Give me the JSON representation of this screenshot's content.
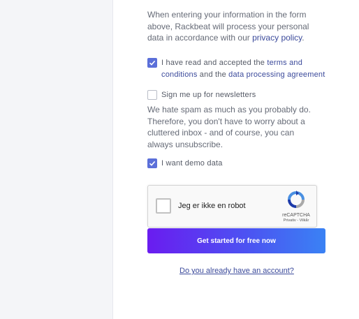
{
  "intro": {
    "text_before": "When entering your information in the form above, Rackbeat will process your personal data in accordance with our ",
    "privacy_link": "privacy policy",
    "text_after": "."
  },
  "terms": {
    "checked": true,
    "text_before": "I have read and accepted the ",
    "terms_link": "terms and conditions",
    "middle": " and the ",
    "agreement_link": "data processing agreement"
  },
  "newsletter": {
    "checked": false,
    "label": "Sign me up for newsletters",
    "note": "We hate spam as much as you probably do. Therefore, you don't have to worry about a cluttered inbox - and of course, you can always unsubscribe."
  },
  "demo": {
    "checked": true,
    "label": "I want demo data"
  },
  "captcha": {
    "label": "Jeg er ikke en robot",
    "brand": "reCAPTCHA",
    "terms": "Privativ - Vilkår"
  },
  "cta_label": "Get started for free now",
  "account_link": "Do you already have an account?",
  "colors": {
    "accent": "#5b6fd9",
    "link": "#3b4a9b",
    "cta_gradient_start": "#6a1cf0",
    "cta_gradient_end": "#3a82f4"
  }
}
